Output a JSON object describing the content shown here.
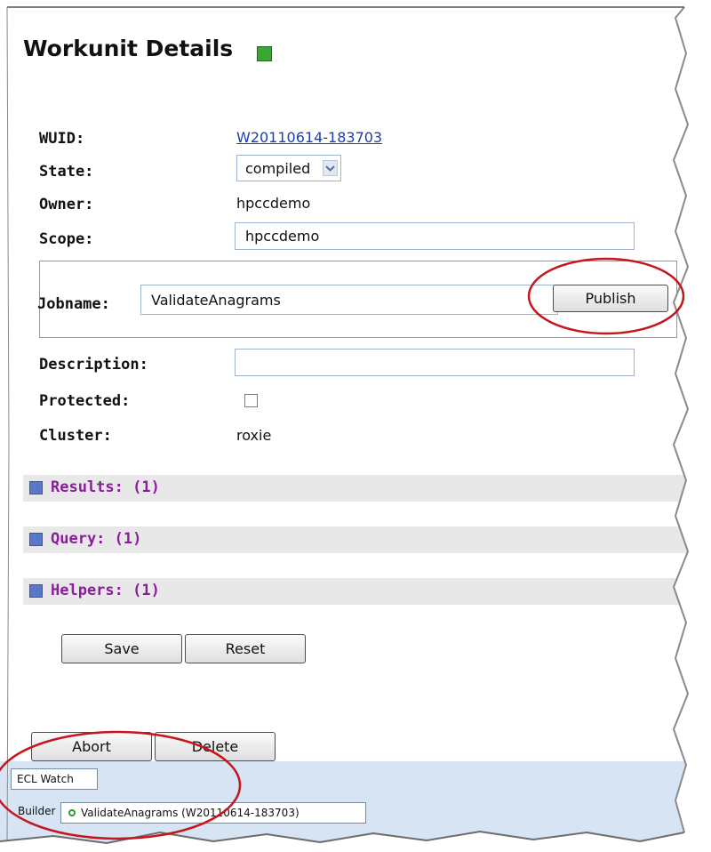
{
  "header": {
    "title": "Workunit Details",
    "refresh_icon": "refresh-icon"
  },
  "fields": {
    "wuid": {
      "label": "WUID:",
      "value": "W20110614-183703"
    },
    "state": {
      "label": "State:",
      "value": "compiled"
    },
    "owner": {
      "label": "Owner:",
      "value": "hpccdemo"
    },
    "scope": {
      "label": "Scope:",
      "value": "hpccdemo"
    },
    "jobname": {
      "label": "Jobname:",
      "value": "ValidateAnagrams",
      "publish_label": "Publish"
    },
    "description": {
      "label": "Description:",
      "value": ""
    },
    "protected": {
      "label": "Protected:",
      "checked": false
    },
    "cluster": {
      "label": "Cluster:",
      "value": "roxie"
    }
  },
  "sections": [
    {
      "label": "Results: (1)",
      "icon": "expand-icon"
    },
    {
      "label": "Query: (1)",
      "icon": "expand-icon"
    },
    {
      "label": "Helpers: (1)",
      "icon": "expand-icon"
    }
  ],
  "actions": {
    "save": "Save",
    "reset": "Reset",
    "abort": "Abort",
    "delete": "Delete"
  },
  "taskbar": {
    "tab": "ECL Watch",
    "builder_label": "Builder",
    "item": "ValidateAnagrams (W20110614-183703)",
    "item_icon": "status-dot-icon"
  },
  "colors": {
    "section_text": "#8a1e9a",
    "link": "#1a3fb4",
    "callout": "#c4161c",
    "taskbar": "#d7e4f3"
  }
}
